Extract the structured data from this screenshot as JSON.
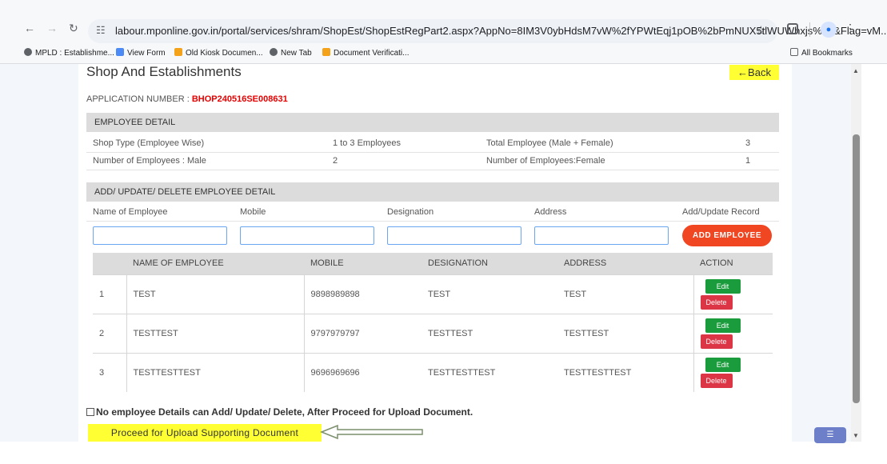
{
  "browser": {
    "url": "labour.mponline.gov.in/portal/services/shram/ShopEst/ShopEstRegPart2.aspx?AppNo=8IM3V0ybHdsM7vW%2fYPWtEqj1pOB%2bPmNUX5tlWUWhxjs%3d&Flag=vM...",
    "bookmarks": [
      {
        "label": "MPLD : Establishme...",
        "icon": "globe-icon",
        "color": "#5f6368"
      },
      {
        "label": "View Form",
        "icon": "form-icon",
        "color": "#4c8bf5"
      },
      {
        "label": "Old Kiosk Documen...",
        "icon": "doc-icon",
        "color": "#f4a21a"
      },
      {
        "label": "New Tab",
        "icon": "globe-icon",
        "color": "#5f6368"
      },
      {
        "label": "Document Verificati...",
        "icon": "doc-icon",
        "color": "#f4a21a"
      }
    ],
    "all_bookmarks": "All Bookmarks"
  },
  "page": {
    "title": "Shop And Establishments",
    "back_label": "←Back",
    "app_number_label": "APPLICATION NUMBER : ",
    "app_number": "BHOP240516SE008631"
  },
  "employee_detail": {
    "header": "EMPLOYEE DETAIL",
    "rows": [
      {
        "label1": "Shop Type (Employee Wise)",
        "value1": "1 to 3 Employees",
        "label2": "Total Employee (Male + Female)",
        "value2": "3"
      },
      {
        "label1": "Number of Employees : Male",
        "value1": "2",
        "label2": "Number of Employees:Female",
        "value2": "1"
      }
    ]
  },
  "form": {
    "header": "ADD/ UPDATE/ DELETE EMPLOYEE DETAIL",
    "labels": {
      "name": "Name of Employee",
      "mobile": "Mobile",
      "designation": "Designation",
      "address": "Address",
      "record": "Add/Update Record"
    },
    "values": {
      "name": "",
      "mobile": "",
      "designation": "",
      "address": ""
    },
    "add_button": "ADD EMPLOYEE"
  },
  "employees": {
    "headers": {
      "name": "NAME OF EMPLOYEE",
      "mobile": "MOBILE",
      "designation": "DESIGNATION",
      "address": "ADDRESS",
      "action": "ACTION"
    },
    "rows": [
      {
        "sno": "1",
        "name": "TEST",
        "mobile": "9898989898",
        "designation": "TEST",
        "address": "TEST"
      },
      {
        "sno": "2",
        "name": "TESTTEST",
        "mobile": "9797979797",
        "designation": "TESTTEST",
        "address": "TESTTEST"
      },
      {
        "sno": "3",
        "name": "TESTTESTTEST",
        "mobile": "9696969696",
        "designation": "TESTTESTTEST",
        "address": "TESTTESTTEST"
      }
    ],
    "edit_label": "Edit",
    "delete_label": "Delete"
  },
  "footer": {
    "checkbox_label": "No employee Details can Add/ Update/ Delete, After Proceed for Upload Document.",
    "checkbox_checked": false,
    "proceed_label": "Proceed for Upload Supporting Document"
  },
  "colors": {
    "accent": "#e60000",
    "highlight": "#ffff33",
    "add_button": "#f04622",
    "edit": "#1a9c3c",
    "delete": "#dc3545"
  }
}
